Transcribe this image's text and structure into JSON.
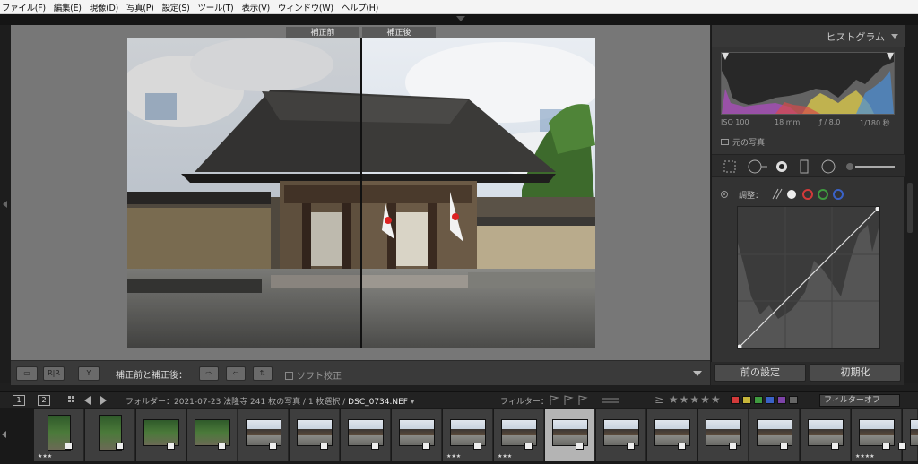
{
  "menubar": {
    "items": [
      "ファイル(F)",
      "編集(E)",
      "現像(D)",
      "写真(P)",
      "設定(S)",
      "ツール(T)",
      "表示(V)",
      "ウィンドウ(W)",
      "ヘルプ(H)"
    ]
  },
  "viewer": {
    "before_label": "補正前",
    "after_label": "補正後"
  },
  "toolbar": {
    "compare_label": "補正前と補正後：",
    "soft_proof_label": "ソフト校正"
  },
  "histogram": {
    "title": "ヒストグラム",
    "iso": "ISO 100",
    "focal": "18 mm",
    "aperture": "ƒ / 8.0",
    "shutter": "1/180 秒",
    "original_label": "元の写真"
  },
  "tone_curve": {
    "adjust_label": "調整：",
    "points": [
      [
        0,
        0
      ],
      [
        1,
        1
      ]
    ]
  },
  "panel_buttons": {
    "previous": "前の設定",
    "reset": "初期化"
  },
  "filmbar": {
    "page1": "1",
    "page2": "2",
    "folder_prefix": "フォルダー：2021-07-23 法隆寺  241 枚の写真 / 1 枚選択 / ",
    "filename": "DSC_0734.NEF",
    "filter_label": "フィルター：",
    "stars": "≥ ★★★★★",
    "filter_off": "フィルターオフ"
  },
  "filmstrip": {
    "cells": [
      {
        "num": "",
        "kind": "forest",
        "portrait": true,
        "stars": "★★★"
      },
      {
        "num": "",
        "kind": "forest",
        "portrait": true,
        "stars": ""
      },
      {
        "num": "",
        "kind": "forest",
        "portrait": false,
        "stars": ""
      },
      {
        "num": "",
        "kind": "forest",
        "portrait": false,
        "stars": ""
      },
      {
        "num": "",
        "kind": "temple",
        "portrait": false,
        "stars": ""
      },
      {
        "num": "",
        "kind": "temple",
        "portrait": false,
        "stars": ""
      },
      {
        "num": "",
        "kind": "temple",
        "portrait": false,
        "stars": ""
      },
      {
        "num": "",
        "kind": "temple",
        "portrait": false,
        "stars": ""
      },
      {
        "num": "",
        "kind": "temple",
        "portrait": false,
        "stars": "★★★"
      },
      {
        "num": "",
        "kind": "temple",
        "portrait": false,
        "stars": "★★★"
      },
      {
        "num": "",
        "kind": "temple",
        "portrait": false,
        "stars": "",
        "selected": true
      },
      {
        "num": "",
        "kind": "temple",
        "portrait": false,
        "stars": ""
      },
      {
        "num": "",
        "kind": "temple",
        "portrait": false,
        "stars": ""
      },
      {
        "num": "",
        "kind": "temple",
        "portrait": false,
        "stars": ""
      },
      {
        "num": "",
        "kind": "temple",
        "portrait": false,
        "stars": ""
      },
      {
        "num": "",
        "kind": "temple",
        "portrait": false,
        "stars": ""
      },
      {
        "num": "",
        "kind": "temple",
        "portrait": false,
        "stars": "★★★★"
      },
      {
        "num": "",
        "kind": "temple",
        "portrait": false,
        "stars": ""
      }
    ]
  },
  "colors": {
    "panel_bg": "#333333",
    "viewer_bg": "#777777",
    "label_red": "#d23a3a",
    "label_yellow": "#c7b63a",
    "label_green": "#3f9a3f",
    "label_blue": "#3a62c7",
    "label_purple": "#7d43a8"
  }
}
